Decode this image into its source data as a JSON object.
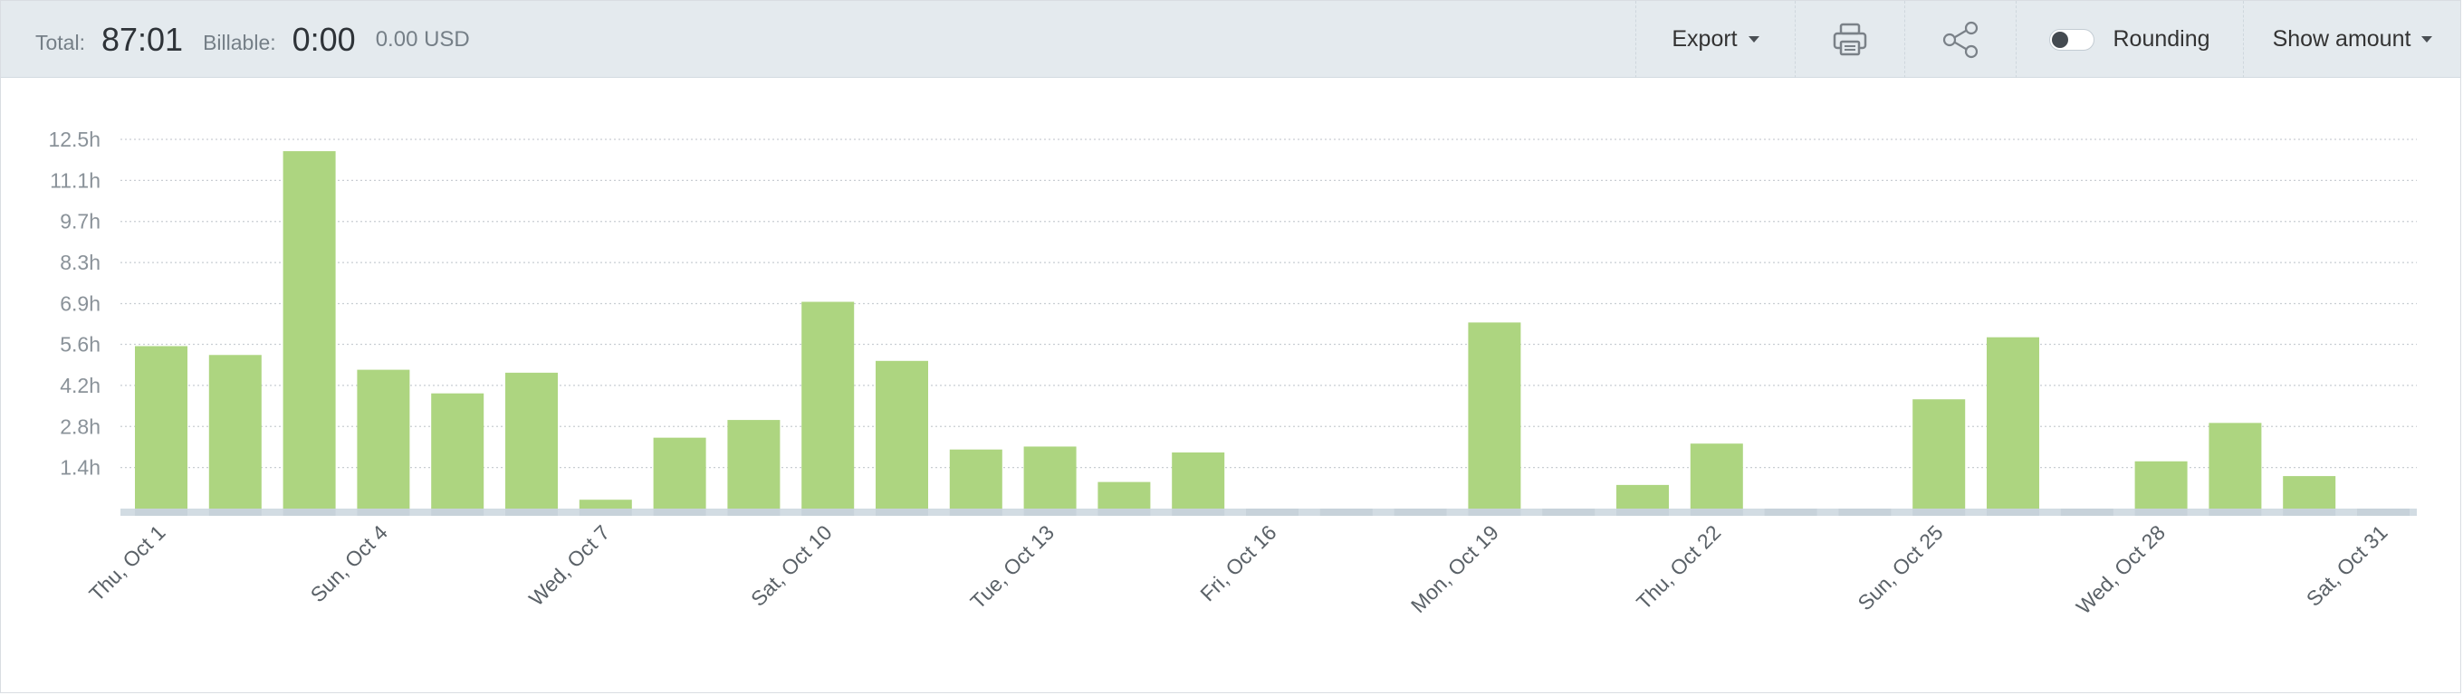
{
  "header": {
    "total_label": "Total:",
    "total_value": "87:01",
    "billable_label": "Billable:",
    "billable_value": "0:00",
    "amount": "0.00 USD",
    "export_label": "Export",
    "print_icon": "printer-icon",
    "share_icon": "share-icon",
    "rounding_label": "Rounding",
    "rounding_on": false,
    "show_amount_label": "Show amount"
  },
  "colors": {
    "bar": "#add580",
    "baseline": "#d2dce3",
    "grid": "#c9ced3",
    "axis_text": "#8a9299",
    "header_bg": "#e4eaee"
  },
  "chart_data": {
    "type": "bar",
    "ylabel": "",
    "ylim": [
      0,
      13.5
    ],
    "y_ticks": [
      "1.4h",
      "2.8h",
      "4.2h",
      "5.6h",
      "6.9h",
      "8.3h",
      "9.7h",
      "11.1h",
      "12.5h"
    ],
    "y_tick_values": [
      1.39,
      2.78,
      4.17,
      5.56,
      6.94,
      8.33,
      9.72,
      11.11,
      12.5
    ],
    "grid": true,
    "categories": [
      "Thu, Oct 1",
      "Fri, Oct 2",
      "Sat, Oct 3",
      "Sun, Oct 4",
      "Mon, Oct 5",
      "Tue, Oct 6",
      "Wed, Oct 7",
      "Thu, Oct 8",
      "Fri, Oct 9",
      "Sat, Oct 10",
      "Sun, Oct 11",
      "Mon, Oct 12",
      "Tue, Oct 13",
      "Wed, Oct 14",
      "Thu, Oct 15",
      "Fri, Oct 16",
      "Sat, Oct 17",
      "Sun, Oct 18",
      "Mon, Oct 19",
      "Tue, Oct 20",
      "Wed, Oct 21",
      "Thu, Oct 22",
      "Fri, Oct 23",
      "Sat, Oct 24",
      "Sun, Oct 25",
      "Mon, Oct 26",
      "Tue, Oct 27",
      "Wed, Oct 28",
      "Thu, Oct 29",
      "Fri, Oct 30",
      "Sat, Oct 31"
    ],
    "visible_x_labels": [
      "Thu, Oct 1",
      "Sun, Oct 4",
      "Wed, Oct 7",
      "Sat, Oct 10",
      "Tue, Oct 13",
      "Fri, Oct 16",
      "Mon, Oct 19",
      "Thu, Oct 22",
      "Sun, Oct 25",
      "Wed, Oct 28",
      "Sat, Oct 31"
    ],
    "values": [
      5.5,
      5.2,
      12.1,
      4.7,
      3.9,
      4.6,
      0.3,
      2.4,
      3.0,
      7.0,
      5.0,
      2.0,
      2.1,
      0.9,
      1.9,
      0,
      0,
      0,
      6.3,
      0,
      0.8,
      2.2,
      0,
      0,
      3.7,
      5.8,
      0,
      1.6,
      2.9,
      1.1,
      0
    ]
  }
}
